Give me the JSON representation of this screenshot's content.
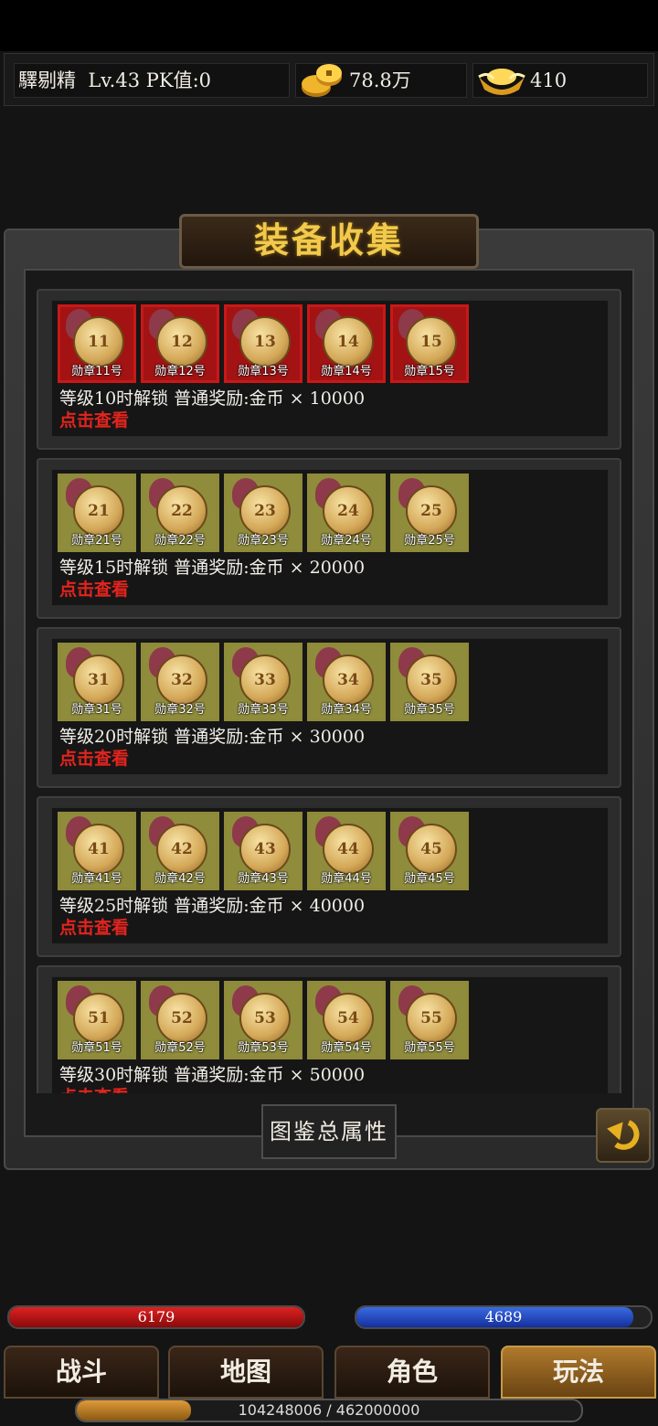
{
  "player": {
    "name": "驛剔精",
    "level": "Lv.43",
    "pk": "PK值:0"
  },
  "currency": {
    "gold": "78.8万",
    "ingot": "410"
  },
  "panel": {
    "title": "装备收集"
  },
  "colors": {
    "accent_gold": "#f2c94c",
    "link_red": "#e3241e",
    "medal_border_unlocked": "#c91818",
    "medal_border_locked": "#8e8a3a"
  },
  "collections": [
    {
      "unlock": "等级10时解锁 普通奖励:金币 × 10000",
      "view": "点击查看",
      "unlocked": true,
      "medals": [
        {
          "num": "11",
          "label": "勋章11号"
        },
        {
          "num": "12",
          "label": "勋章12号"
        },
        {
          "num": "13",
          "label": "勋章13号"
        },
        {
          "num": "14",
          "label": "勋章14号"
        },
        {
          "num": "15",
          "label": "勋章15号"
        }
      ]
    },
    {
      "unlock": "等级15时解锁 普通奖励:金币 × 20000",
      "view": "点击查看",
      "unlocked": false,
      "medals": [
        {
          "num": "21",
          "label": "勋章21号"
        },
        {
          "num": "22",
          "label": "勋章22号"
        },
        {
          "num": "23",
          "label": "勋章23号"
        },
        {
          "num": "24",
          "label": "勋章24号"
        },
        {
          "num": "25",
          "label": "勋章25号"
        }
      ]
    },
    {
      "unlock": "等级20时解锁 普通奖励:金币 × 30000",
      "view": "点击查看",
      "unlocked": false,
      "medals": [
        {
          "num": "31",
          "label": "勋章31号"
        },
        {
          "num": "32",
          "label": "勋章32号"
        },
        {
          "num": "33",
          "label": "勋章33号"
        },
        {
          "num": "34",
          "label": "勋章34号"
        },
        {
          "num": "35",
          "label": "勋章35号"
        }
      ]
    },
    {
      "unlock": "等级25时解锁 普通奖励:金币 × 40000",
      "view": "点击查看",
      "unlocked": false,
      "medals": [
        {
          "num": "41",
          "label": "勋章41号"
        },
        {
          "num": "42",
          "label": "勋章42号"
        },
        {
          "num": "43",
          "label": "勋章43号"
        },
        {
          "num": "44",
          "label": "勋章44号"
        },
        {
          "num": "45",
          "label": "勋章45号"
        }
      ]
    },
    {
      "unlock": "等级30时解锁 普通奖励:金币 × 50000",
      "view": "点击查看",
      "unlocked": false,
      "medals": [
        {
          "num": "51",
          "label": "勋章51号"
        },
        {
          "num": "52",
          "label": "勋章52号"
        },
        {
          "num": "53",
          "label": "勋章53号"
        },
        {
          "num": "54",
          "label": "勋章54号"
        },
        {
          "num": "55",
          "label": "勋章55号"
        }
      ]
    }
  ],
  "buttons": {
    "summary": "图鉴总属性",
    "back_icon": "return-arrow-icon"
  },
  "stats": {
    "hp": "6179",
    "mp": "4689",
    "hp_fill": 1.0,
    "mp_fill": 0.94,
    "exp": "104248006 / 462000000",
    "exp_fill": 0.2256
  },
  "nav": [
    {
      "label": "战斗"
    },
    {
      "label": "地图"
    },
    {
      "label": "角色"
    },
    {
      "label": "玩法"
    }
  ]
}
